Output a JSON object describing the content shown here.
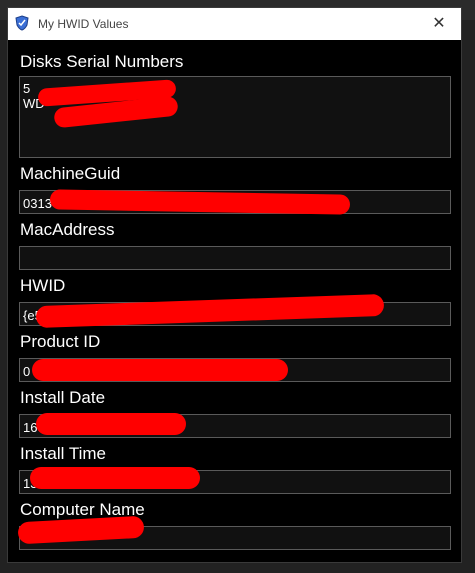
{
  "window": {
    "title": "My HWID Values",
    "icons": {
      "app": "shield-icon",
      "close": "close-icon"
    },
    "close_glyph": "✕"
  },
  "fields": [
    {
      "label": "Disks Serial Numbers",
      "value": "5\nWD"
    },
    {
      "label": "MachineGuid",
      "value": "0313"
    },
    {
      "label": "MacAddress",
      "value": ""
    },
    {
      "label": "HWID",
      "value": "{e5"
    },
    {
      "label": "Product ID",
      "value": "0"
    },
    {
      "label": "Install Date",
      "value": "16"
    },
    {
      "label": "Install Time",
      "value": "13"
    },
    {
      "label": "Computer Name",
      "value": ""
    }
  ],
  "colors": {
    "background": "#000000",
    "redaction": "#ff0000",
    "text": "#ffffff"
  }
}
